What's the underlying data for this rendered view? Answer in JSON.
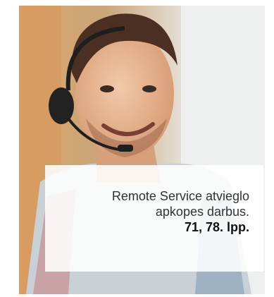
{
  "caption": {
    "line1": "Remote Service atvieglo",
    "line2": "apkopes darbus.",
    "pages": "71, 78. lpp."
  },
  "colors": {
    "overlay": "#ffffff",
    "text": "#333333"
  }
}
